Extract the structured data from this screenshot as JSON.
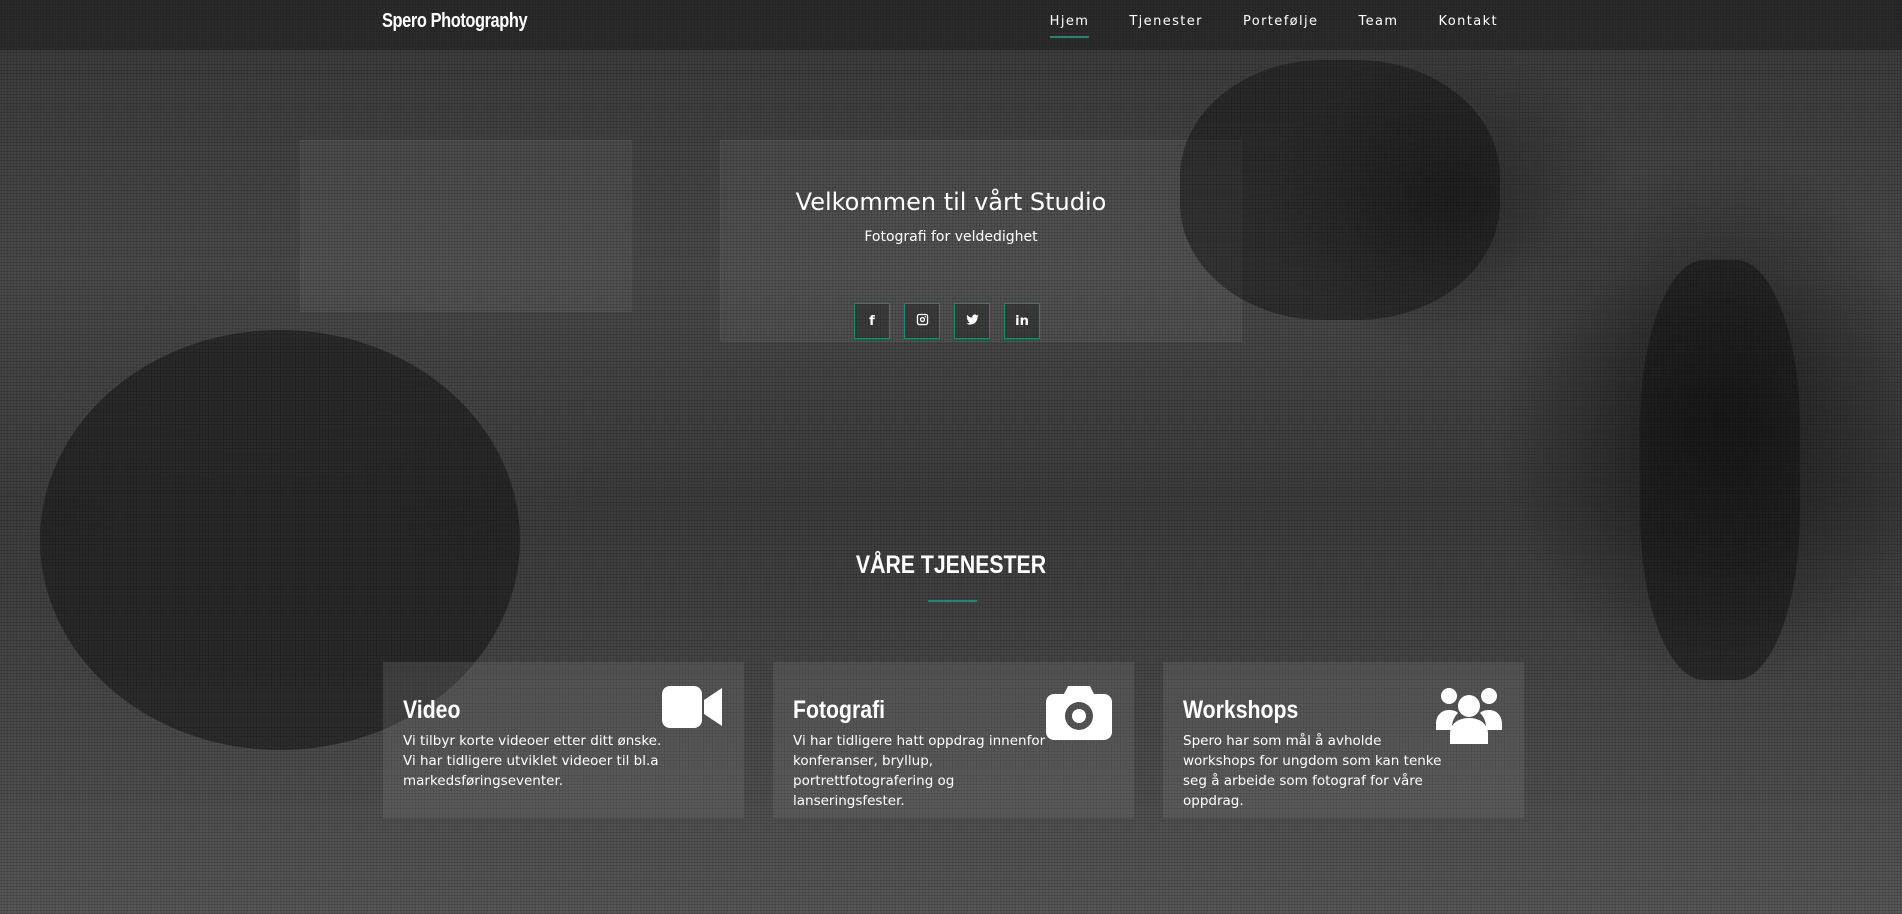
{
  "brand": "Spero Photography",
  "nav": {
    "items": [
      {
        "label": "Hjem",
        "active": true
      },
      {
        "label": "Tjenester",
        "active": false
      },
      {
        "label": "Portefølje",
        "active": false
      },
      {
        "label": "Team",
        "active": false
      },
      {
        "label": "Kontakt",
        "active": false
      }
    ]
  },
  "hero": {
    "title": "Velkommen til vårt Studio",
    "subtitle": "Fotografi for veldedighet",
    "social": [
      {
        "name": "facebook-icon",
        "glyph": "f"
      },
      {
        "name": "instagram-icon",
        "glyph": ""
      },
      {
        "name": "twitter-icon",
        "glyph": ""
      },
      {
        "name": "linkedin-icon",
        "glyph": "in"
      }
    ]
  },
  "services": {
    "title": "VÅRE TJENESTER",
    "cards": [
      {
        "title": "Video",
        "text": "Vi tilbyr korte videoer etter ditt ønske. Vi har tidligere utviklet videoer til bl.a markedsføringseventer.",
        "icon": "video-camera-icon"
      },
      {
        "title": "Fotografi",
        "text": "Vi har tidligere hatt oppdrag innenfor konferanser, bryllup, portrettfotografering og lanseringsfester.",
        "icon": "camera-icon"
      },
      {
        "title": "Workshops",
        "text": "Spero har som mål å avholde workshops for ungdom som kan tenke seg å arbeide som fotograf for våre oppdrag.",
        "icon": "users-icon"
      }
    ]
  },
  "colors": {
    "accent": "#1a8a74",
    "navbar_bg": "rgba(30,30,30,0.55)",
    "card_bg": "rgba(120,120,120,0.28)"
  }
}
